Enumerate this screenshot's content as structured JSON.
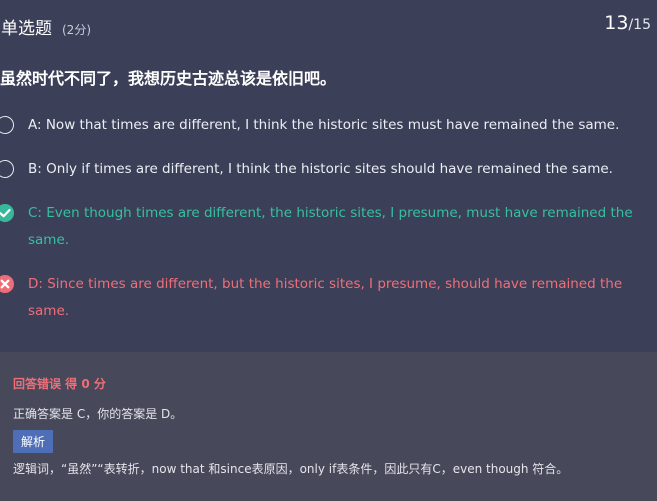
{
  "header": {
    "question_type": "单选题",
    "score": "(2分)",
    "current": "13",
    "total": "/15"
  },
  "question": {
    "stem": "虽然时代不同了，我想历史古迹总该是依旧吧。"
  },
  "options": [
    {
      "label": "A: Now that times are different, I think the historic sites must have remained the same.",
      "state": "unselected"
    },
    {
      "label": "B: Only if times are different, I think the historic sites should have remained the same.",
      "state": "unselected"
    },
    {
      "label": "C: Even though times are different, the historic sites, I presume, must have remained the same.",
      "state": "correct"
    },
    {
      "label": "D: Since times are different, but the historic sites, I presume, should have remained the same.",
      "state": "wrong"
    }
  ],
  "feedback": {
    "result": "回答错误 得 0 分",
    "answer_text": "正确答案是 C，你的答案是 D。",
    "analysis_tag": "解析",
    "explanation": "逻辑词，“虽然”“表转折，now that 和since表原因，only if表条件，因此只有C，even though 符合。"
  },
  "colors": {
    "background": "#3c3f58",
    "feedback_bg": "#474859",
    "correct": "#36c0a0",
    "wrong": "#ef6f79",
    "tag": "#4e6fb7"
  },
  "icons": {
    "unselected": "radio-empty-icon",
    "correct": "check-circle-icon",
    "wrong": "x-circle-icon"
  }
}
